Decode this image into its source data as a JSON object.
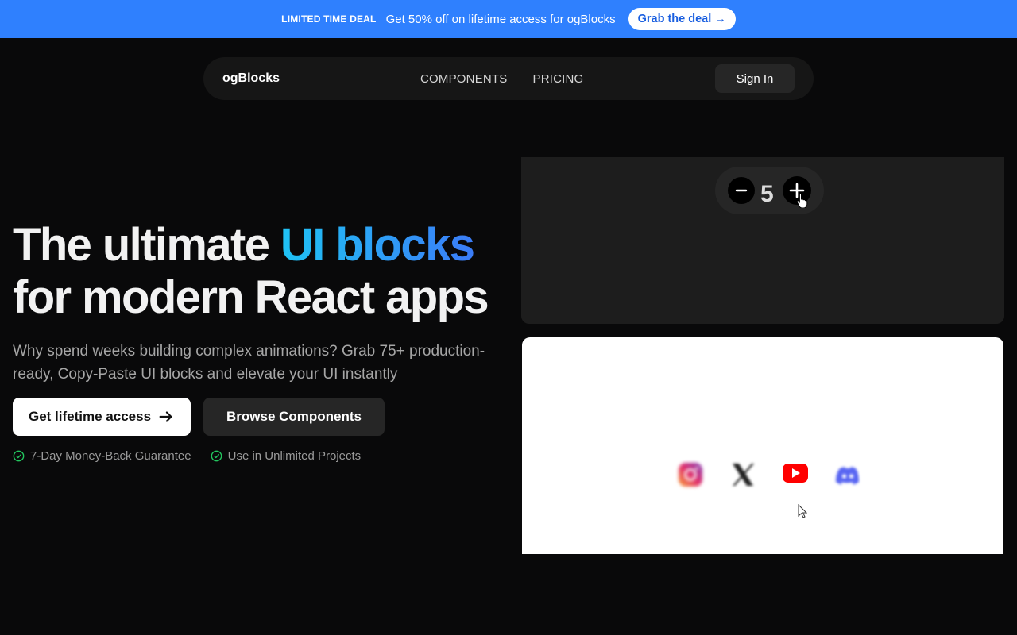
{
  "banner": {
    "tag": "LIMITED TIME DEAL",
    "message": "Get 50% off on lifetime access for ogBlocks",
    "cta_label": "Grab the deal →"
  },
  "nav": {
    "logo": "ogBlocks",
    "links": [
      "COMPONENTS",
      "PRICING"
    ],
    "signin_label": "Sign In"
  },
  "hero": {
    "title_part1": "The ultimate ",
    "title_accent": "UI blocks",
    "title_part2": "for modern React apps",
    "subtitle": "Why spend weeks building complex animations? Grab 75+ production-ready, Copy-Paste UI blocks and elevate your UI instantly",
    "primary_button": "Get lifetime access",
    "secondary_button": "Browse Components",
    "guarantees": [
      "7-Day Money-Back Guarantee",
      "Use in Unlimited Projects"
    ]
  },
  "preview": {
    "counter_value": "5",
    "social_icons": [
      "instagram-icon",
      "x-icon",
      "youtube-icon",
      "discord-icon"
    ]
  },
  "colors": {
    "banner_bg": "#2f80fe",
    "accent_start": "#1fc3f5",
    "accent_end": "#3b7cf6",
    "check_green": "#22c55e",
    "page_bg": "#09090a"
  }
}
